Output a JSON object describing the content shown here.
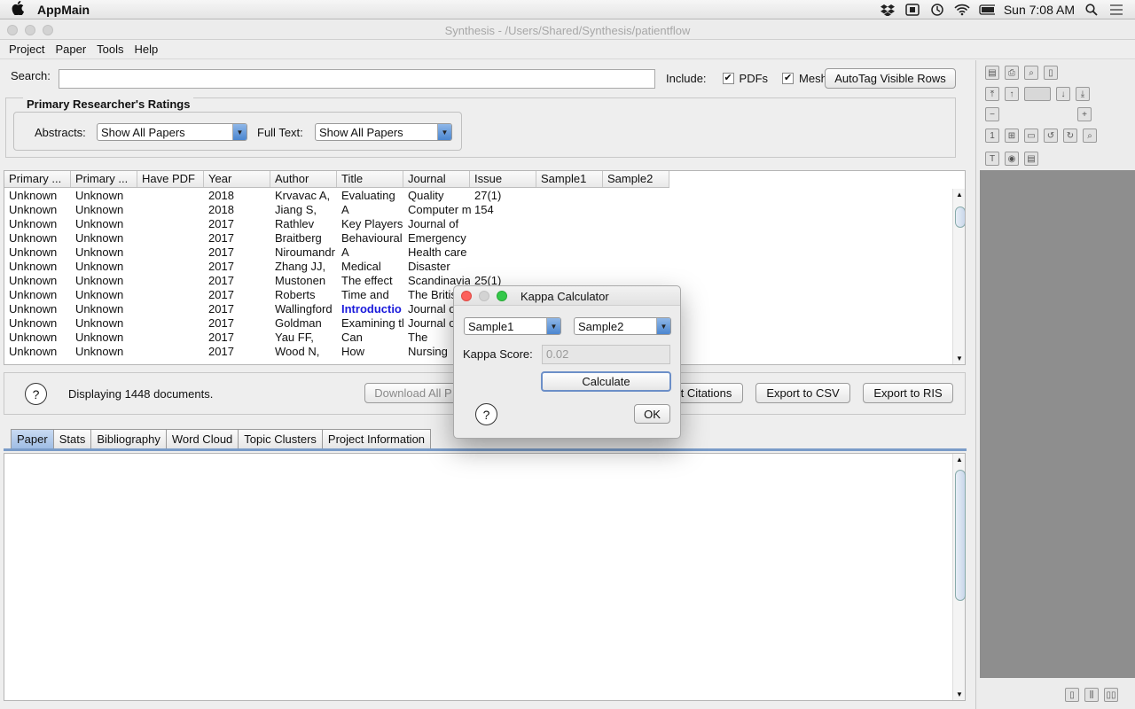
{
  "os_menubar": {
    "app_name": "AppMain",
    "clock": "Sun 7:08 AM"
  },
  "window": {
    "title": "Synthesis - /Users/Shared/Synthesis/patientflow"
  },
  "app_menu": [
    "Project",
    "Paper",
    "Tools",
    "Help"
  ],
  "search": {
    "label": "Search:",
    "value": "",
    "include_label": "Include:",
    "pdfs_label": "PDFs",
    "mesh_label": "Mesh",
    "pdfs_checked": true,
    "mesh_checked": true,
    "autotag_label": "AutoTag Visible Rows"
  },
  "ratings": {
    "title": "Primary Researcher's  Ratings",
    "abstracts_label": "Abstracts:",
    "abstracts_value": "Show All Papers",
    "fulltext_label": "Full Text:",
    "fulltext_value": "Show All Papers"
  },
  "table": {
    "columns": [
      "Primary ...",
      "Primary ...",
      "Have PDF",
      "Year",
      "Author",
      "Title",
      "Journal",
      "Issue",
      "Sample1",
      "Sample2"
    ],
    "rows": [
      [
        "Unknown",
        "Unknown",
        "",
        "2018",
        "Krvavac A,",
        "Evaluating",
        "Quality",
        "27(1)",
        "",
        ""
      ],
      [
        "Unknown",
        "Unknown",
        "",
        "2018",
        "Jiang S,",
        "A",
        "Computer m",
        "154",
        "",
        ""
      ],
      [
        "Unknown",
        "Unknown",
        "",
        "2017",
        "Rathlev",
        "Key Players",
        "Journal of",
        "",
        "",
        ""
      ],
      [
        "Unknown",
        "Unknown",
        "",
        "2017",
        "Braitberg",
        "Behavioural",
        "Emergency",
        "",
        "",
        ""
      ],
      [
        "Unknown",
        "Unknown",
        "",
        "2017",
        "Niroumandr",
        "A",
        "Health care",
        "",
        "",
        ""
      ],
      [
        "Unknown",
        "Unknown",
        "",
        "2017",
        "Zhang JJ,",
        "Medical",
        "Disaster",
        "",
        "",
        ""
      ],
      [
        "Unknown",
        "Unknown",
        "",
        "2017",
        "Mustonen",
        "The effect",
        "Scandinaviar",
        "25(1)",
        "",
        ""
      ],
      [
        "Unknown",
        "Unknown",
        "",
        "2017",
        "Roberts",
        "Time and",
        "The Britis",
        "",
        "",
        ""
      ],
      [
        "Unknown",
        "Unknown",
        "",
        "2017",
        "Wallingford",
        "Introductio",
        "Journal o",
        "",
        "",
        ""
      ],
      [
        "Unknown",
        "Unknown",
        "",
        "2017",
        "Goldman",
        "Examining th",
        "Journal o",
        "",
        "",
        ""
      ],
      [
        "Unknown",
        "Unknown",
        "",
        "2017",
        "Yau FF,",
        "Can",
        "The",
        "",
        "",
        ""
      ],
      [
        "Unknown",
        "Unknown",
        "",
        "2017",
        "Wood N,",
        "How",
        "Nursing",
        "",
        "",
        ""
      ]
    ]
  },
  "status": {
    "help_glyph": "?",
    "count_text": "Displaying 1448 documents.",
    "download_label": "Download All P",
    "citations_label": "t Citations",
    "export_csv_label": "Export to CSV",
    "export_ris_label": "Export to RIS"
  },
  "tabs": [
    "Paper",
    "Stats",
    "Bibliography",
    "Word Cloud",
    "Topic Clusters",
    "Project Information"
  ],
  "kappa_dialog": {
    "title": "Kappa Calculator",
    "sample1": "Sample1",
    "sample2": "Sample2",
    "score_label": "Kappa Score:",
    "score_value": "0.02",
    "calculate_label": "Calculate",
    "ok_label": "OK",
    "help_glyph": "?"
  },
  "colors": {
    "link_blue": "#1a1adb",
    "accent_tab": "#9fbde4",
    "pdf_panel": "#8e8e8e"
  }
}
